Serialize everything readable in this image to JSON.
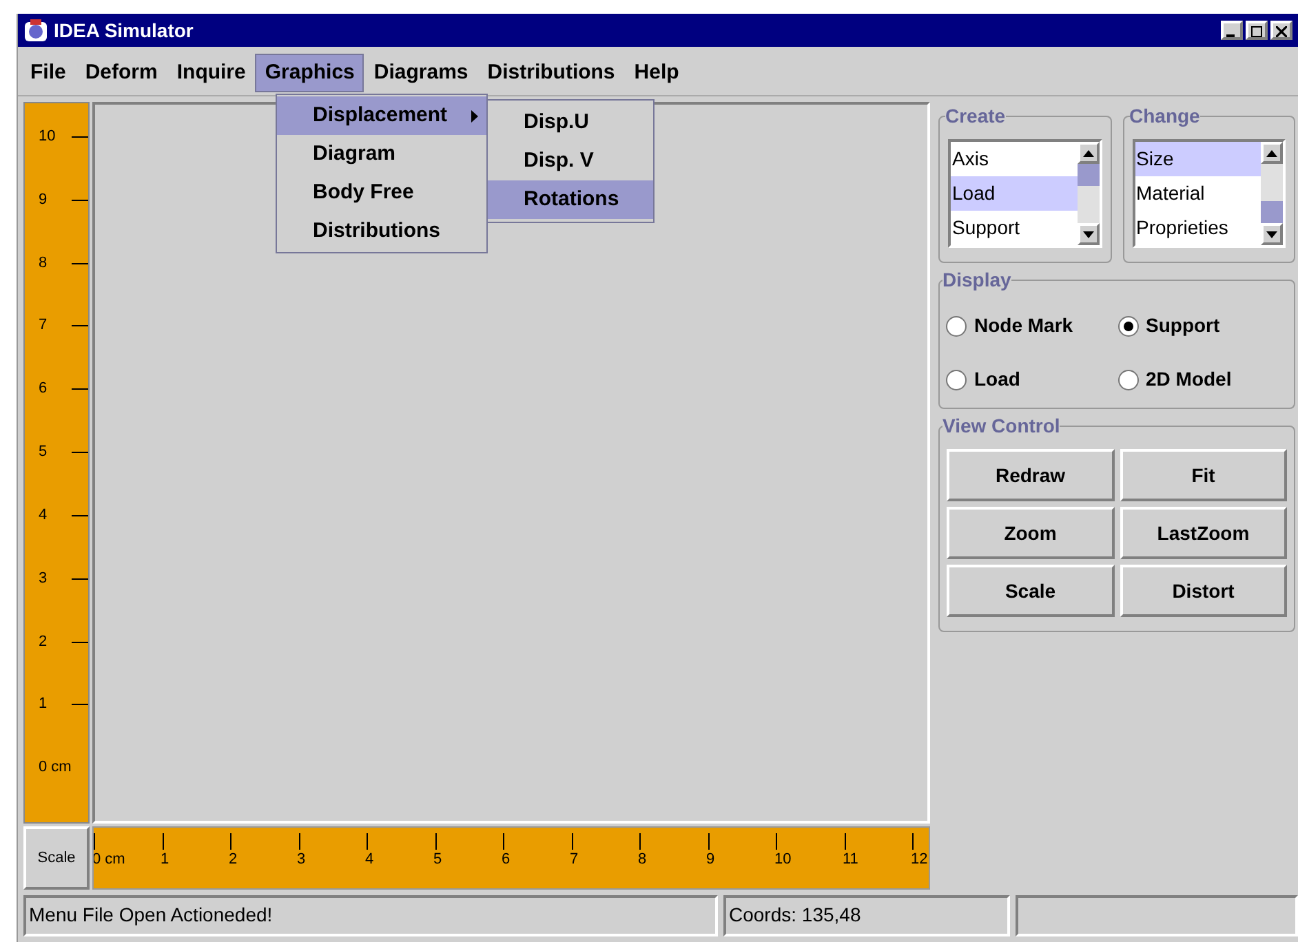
{
  "window": {
    "title": "IDEA Simulator"
  },
  "menu_bar": [
    {
      "label": "File",
      "selected": false
    },
    {
      "label": "Deform",
      "selected": false
    },
    {
      "label": "Inquire",
      "selected": false
    },
    {
      "label": "Graphics",
      "selected": true
    },
    {
      "label": "Diagrams",
      "selected": false
    },
    {
      "label": "Distributions",
      "selected": false
    },
    {
      "label": "Help",
      "selected": false
    }
  ],
  "open_menu": [
    {
      "label": "Displacement",
      "selected": true,
      "has_submenu": true
    },
    {
      "label": "Diagram",
      "selected": false,
      "has_submenu": false
    },
    {
      "label": "Body Free",
      "selected": false,
      "has_submenu": false
    },
    {
      "label": "Distributions",
      "selected": false,
      "has_submenu": false
    }
  ],
  "submenu": [
    {
      "label": "Disp.U",
      "selected": false
    },
    {
      "label": "Disp. V",
      "selected": false
    },
    {
      "label": "Rotations",
      "selected": true
    }
  ],
  "vertical_ruler": [
    "10",
    "9",
    "8",
    "7",
    "6",
    "5",
    "4",
    "3",
    "2",
    "1",
    "0 cm"
  ],
  "horizontal_ruler": {
    "button": "Scale",
    "ticks": [
      "0 cm",
      "1",
      "2",
      "3",
      "4",
      "5",
      "6",
      "7",
      "8",
      "9",
      "10",
      "11",
      "12"
    ]
  },
  "create": {
    "title": "Create",
    "items": [
      {
        "label": "Axis",
        "selected": false
      },
      {
        "label": "Load",
        "selected": true
      },
      {
        "label": "Support",
        "selected": false
      }
    ]
  },
  "change": {
    "title": "Change",
    "items": [
      {
        "label": "Size",
        "selected": true
      },
      {
        "label": "Material",
        "selected": false
      },
      {
        "label": "Proprieties",
        "selected": false
      }
    ]
  },
  "display": {
    "title": "Display",
    "options": [
      {
        "label": "Node Mark",
        "selected": false
      },
      {
        "label": "Support",
        "selected": true
      },
      {
        "label": "Load",
        "selected": false
      },
      {
        "label": "2D Model",
        "selected": false
      }
    ]
  },
  "view_control": {
    "title": "View Control",
    "buttons": [
      "Redraw",
      "Fit",
      "Zoom",
      "LastZoom",
      "Scale",
      "Distort"
    ]
  },
  "status_bar": {
    "message": "Menu File Open Actioneded!",
    "coords": "Coords: 135,48"
  }
}
